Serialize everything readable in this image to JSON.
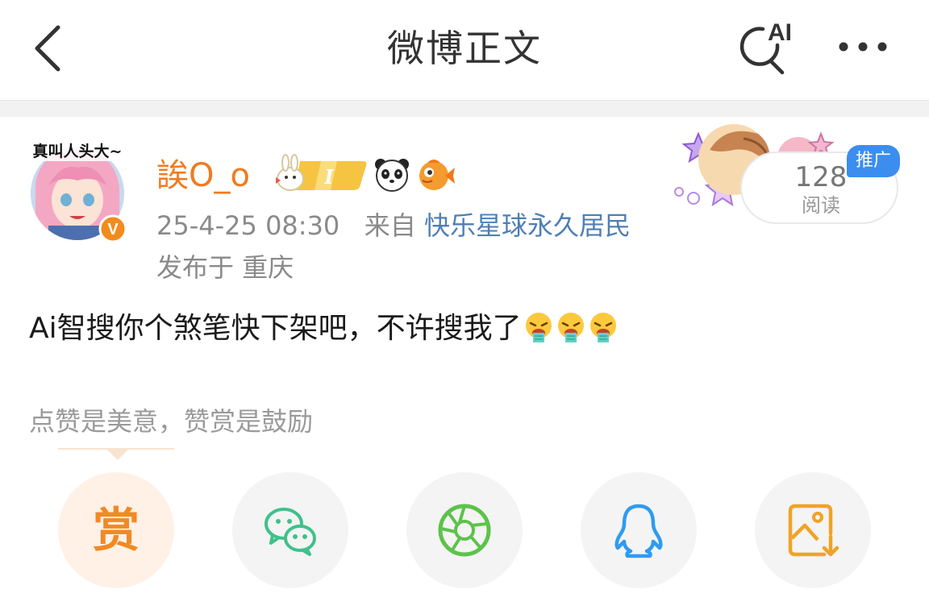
{
  "header": {
    "title": "微博正文",
    "ai_label": "AI"
  },
  "post": {
    "username": "誒O_o",
    "avatar_caption": "真叫人头大~",
    "avatar_verified_mark": "V",
    "time": "25-4-25 08:30",
    "from_label": "来自",
    "source": "快乐星球永久居民",
    "location": "发布于 重庆",
    "content": "Ai智搜你个煞笔快下架吧，不许搜我了",
    "emoji_name": "vomit-emoji",
    "emoji_count": 3
  },
  "badge": {
    "level_label": "I"
  },
  "read_stats": {
    "count": "128",
    "label": "阅读",
    "promo_tag": "推广"
  },
  "reward": {
    "tip": "点赞是美意，赞赏是鼓励",
    "button_label": "赏"
  },
  "share_targets": [
    "reward",
    "wechat",
    "wechat-moments",
    "qq",
    "save-image"
  ],
  "colors": {
    "username": "#f07b1f",
    "source_link": "#4e7fb6",
    "promo_tag": "#3c8df0",
    "reward": "#f08a24",
    "wechat": "#3fc18b",
    "moments": "#5cc34a",
    "qq": "#2f9bef",
    "save": "#f0a326"
  }
}
